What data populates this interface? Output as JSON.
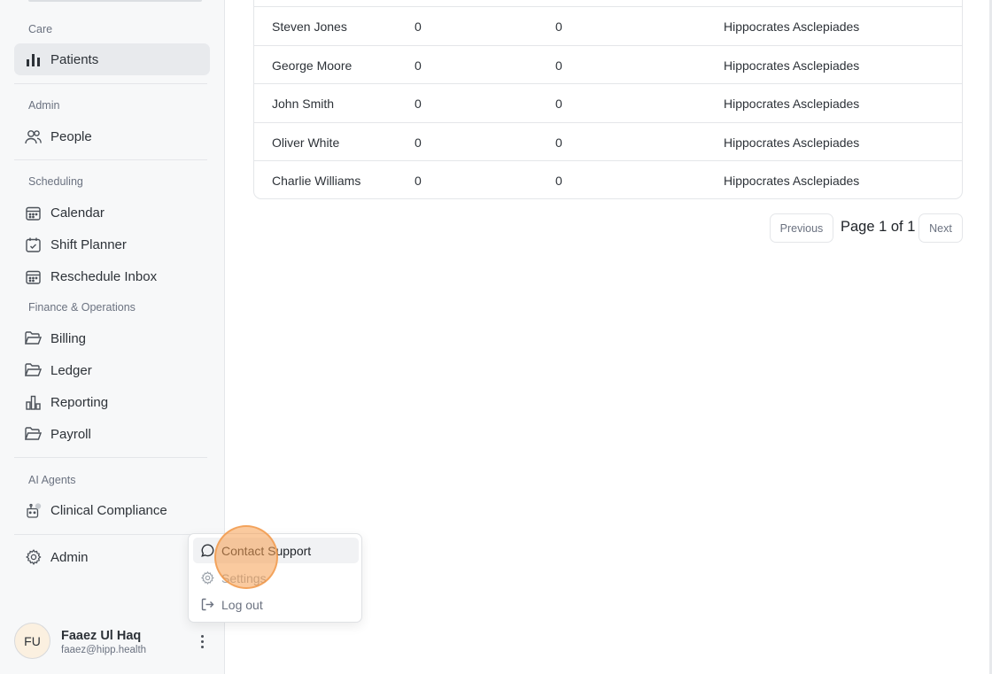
{
  "sidebar": {
    "sections": {
      "care": "Care",
      "admin": "Admin",
      "scheduling": "Scheduling",
      "finance": "Finance & Operations",
      "ai_agents": "AI Agents"
    },
    "items": {
      "patients": "Patients",
      "people": "People",
      "calendar": "Calendar",
      "shift_planner": "Shift Planner",
      "reschedule_inbox": "Reschedule Inbox",
      "billing": "Billing",
      "ledger": "Ledger",
      "reporting": "Reporting",
      "payroll": "Payroll",
      "clinical_compliance": "Clinical Compliance",
      "admin": "Admin"
    },
    "active_item": "Patients"
  },
  "user": {
    "initials": "FU",
    "name": "Faaez Ul Haq",
    "email": "faaez@hipp.health"
  },
  "table": {
    "rows": [
      {
        "name": "Steven Jones",
        "a": "0",
        "b": "0",
        "doctor": "Hippocrates Asclepiades"
      },
      {
        "name": "George Moore",
        "a": "0",
        "b": "0",
        "doctor": "Hippocrates Asclepiades"
      },
      {
        "name": "John Smith",
        "a": "0",
        "b": "0",
        "doctor": "Hippocrates Asclepiades"
      },
      {
        "name": "Oliver White",
        "a": "0",
        "b": "0",
        "doctor": "Hippocrates Asclepiades"
      },
      {
        "name": "Charlie Williams",
        "a": "0",
        "b": "0",
        "doctor": "Hippocrates Asclepiades"
      }
    ]
  },
  "pagination": {
    "previous": "Previous",
    "page_info": "Page 1 of 1",
    "next": "Next"
  },
  "menu": {
    "contact_support": "Contact Support",
    "settings": "Settings",
    "log_out": "Log out"
  },
  "icons": {
    "patients": "bar-chart-icon",
    "people": "users-icon",
    "calendar": "calendar-icon",
    "shift_planner": "calendar-check-icon",
    "reschedule_inbox": "calendar-icon",
    "billing": "folder-open-icon",
    "ledger": "folder-open-icon",
    "reporting": "bar-chart-outline-icon",
    "payroll": "folder-open-icon",
    "clinical_compliance": "robot-icon",
    "admin": "gear-icon",
    "contact_support": "chat-bubble-icon",
    "settings": "gear-icon",
    "log_out": "log-out-icon"
  },
  "colors": {
    "sidebar_bg": "#f7f8f9",
    "active_bg": "#e8eaed",
    "avatar_bg": "#fbf0e0",
    "cursor_halo": "#f59e50"
  }
}
